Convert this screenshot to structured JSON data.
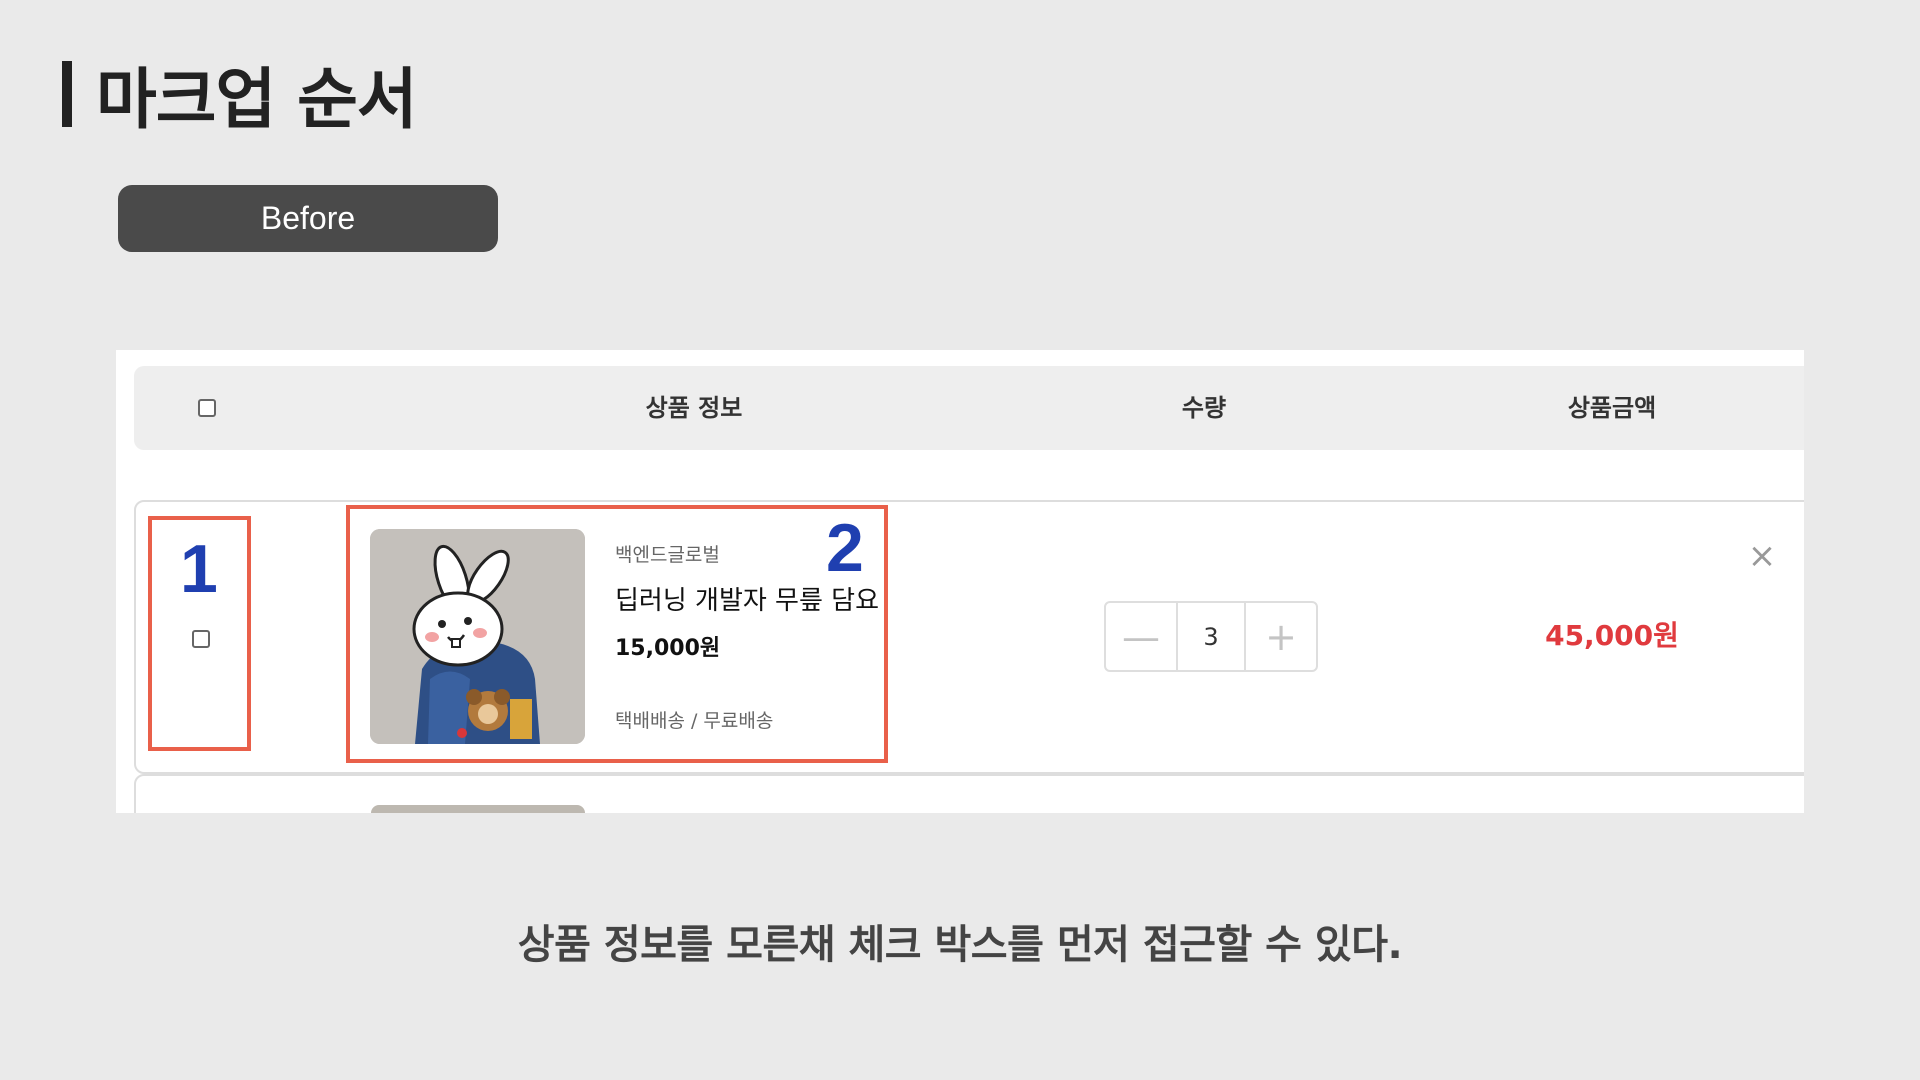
{
  "slide": {
    "title": "마크업 순서",
    "tag_label": "Before",
    "caption": "상품 정보를 모른채 체크 박스를 먼저 접근할 수 있다."
  },
  "cart": {
    "header": {
      "product_info": "상품 정보",
      "quantity": "수량",
      "price": "상품금액"
    },
    "item": {
      "brand": "백엔드글로벌",
      "name": "딥러닝 개발자 무릎 담요",
      "unit_price": "15,000원",
      "shipping": "택배배송 / 무료배송",
      "quantity": "3",
      "line_total": "45,000원",
      "minus_glyph": "—",
      "plus_glyph": "+",
      "remove_glyph": "×"
    }
  },
  "annotations": {
    "box1_number": "1",
    "box2_number": "2"
  },
  "colors": {
    "background": "#eaeaea",
    "annotation_border": "#e9604a",
    "annotation_number": "#1f3fb0",
    "price_red": "#e03a3e",
    "pill": "#4a4a4a"
  },
  "icons": {
    "remove": "close-icon",
    "minus": "minus-icon",
    "plus": "plus-icon"
  }
}
